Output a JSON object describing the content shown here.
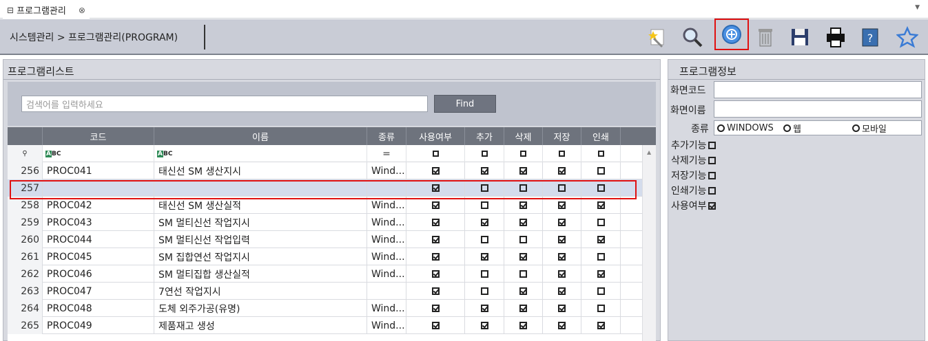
{
  "tab": {
    "icon": "window-icon",
    "label": "프로그램관리",
    "close": "⊗"
  },
  "breadcrumb": "시스템관리 > 프로그램관리(PROGRAM)",
  "toolbar": {
    "buttons": [
      "new-wand-icon",
      "search-icon",
      "add-icon",
      "delete-icon",
      "save-icon",
      "print-icon",
      "help-icon",
      "favorite-icon"
    ],
    "highlighted": "add-icon"
  },
  "left_panel": {
    "title": "프로그램리스트",
    "search_placeholder": "검색어를 입력하세요",
    "find_label": "Find"
  },
  "grid": {
    "columns": [
      "코드",
      "이름",
      "종류",
      "사용여부",
      "추가",
      "삭제",
      "저장",
      "인쇄"
    ],
    "filter_abc": "ABC",
    "filter_eq": "=",
    "rows": [
      {
        "no": "256",
        "code": "PROC041",
        "name": "태신선 SM 생산지시",
        "kind": "Wind...",
        "use": true,
        "add": true,
        "del": true,
        "save": true,
        "print": false
      },
      {
        "no": "257",
        "code": "",
        "name": "",
        "kind": "",
        "use": true,
        "add": false,
        "del": false,
        "save": false,
        "print": false,
        "selected": true
      },
      {
        "no": "258",
        "code": "PROC042",
        "name": "태신선 SM 생산실적",
        "kind": "Wind...",
        "use": true,
        "add": false,
        "del": true,
        "save": true,
        "print": true
      },
      {
        "no": "259",
        "code": "PROC043",
        "name": "SM 멀티신선 작업지시",
        "kind": "Wind...",
        "use": true,
        "add": true,
        "del": true,
        "save": true,
        "print": false
      },
      {
        "no": "260",
        "code": "PROC044",
        "name": "SM 멀티신선 작업입력",
        "kind": "Wind...",
        "use": true,
        "add": false,
        "del": false,
        "save": true,
        "print": true
      },
      {
        "no": "261",
        "code": "PROC045",
        "name": "SM 집합연선 작업지시",
        "kind": "Wind...",
        "use": true,
        "add": true,
        "del": true,
        "save": true,
        "print": false
      },
      {
        "no": "262",
        "code": "PROC046",
        "name": "SM 멀티집합 생산실적",
        "kind": "Wind...",
        "use": true,
        "add": false,
        "del": false,
        "save": true,
        "print": true
      },
      {
        "no": "263",
        "code": "PROC047",
        "name": "7연선 작업지시",
        "kind": "",
        "use": true,
        "add": false,
        "del": true,
        "save": true,
        "print": false
      },
      {
        "no": "264",
        "code": "PROC048",
        "name": "도체 외주가공(유명)",
        "kind": "Wind...",
        "use": true,
        "add": true,
        "del": true,
        "save": true,
        "print": false
      },
      {
        "no": "265",
        "code": "PROC049",
        "name": "제품재고 생성",
        "kind": "Wind...",
        "use": true,
        "add": true,
        "del": true,
        "save": true,
        "print": true
      }
    ]
  },
  "right_panel": {
    "title": "프로그램정보",
    "screen_code_label": "화면코드",
    "screen_name_label": "화면이름",
    "kind_label": "종류",
    "kind_options": [
      "WINDOWS",
      "웹",
      "모바일"
    ],
    "add_label": "추가기능",
    "del_label": "삭제기능",
    "save_label": "저장기능",
    "print_label": "인쇄기능",
    "use_label": "사용여부",
    "use_checked": true
  }
}
